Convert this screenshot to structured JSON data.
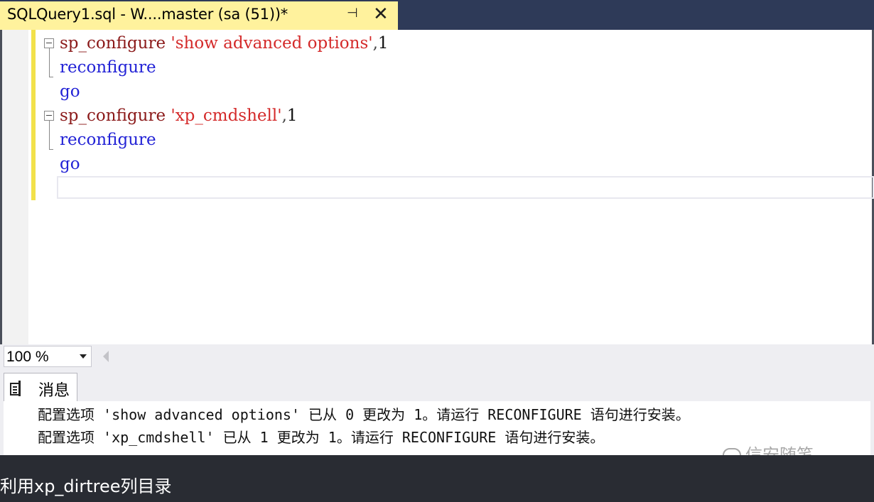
{
  "tab": {
    "title": "SQLQuery1.sql - W....master (sa (51))*",
    "pin_icon": "⊣",
    "close_icon": "✕"
  },
  "editor": {
    "lines": [
      {
        "func": "sp_configure",
        "space": " ",
        "string": "'show advanced options'",
        "comma": ",",
        "number": "1"
      },
      {
        "keyword": "reconfigure"
      },
      {
        "keyword": "go"
      },
      {
        "func": "sp_configure",
        "space": " ",
        "string": "'xp_cmdshell'",
        "comma": ",",
        "number": "1"
      },
      {
        "keyword": "reconfigure"
      },
      {
        "keyword": "go"
      }
    ]
  },
  "footer": {
    "zoom": "100 %"
  },
  "messages": {
    "tab_label": "消息",
    "lines": [
      "配置选项 'show advanced options' 已从 0 更改为 1。请运行 RECONFIGURE 语句进行安装。",
      "配置选项 'xp_cmdshell' 已从 1 更改为 1。请运行 RECONFIGURE 语句进行安装。"
    ],
    "watermark": "信安随笔"
  },
  "caption": "利用xp_dirtree列目录",
  "colors": {
    "keyword_blue": "#2323d6",
    "func_maroon": "#8b1a1a",
    "string_red": "#d42a2a",
    "tab_yellow": "#fff29d",
    "change_bar": "#f2e14a"
  }
}
